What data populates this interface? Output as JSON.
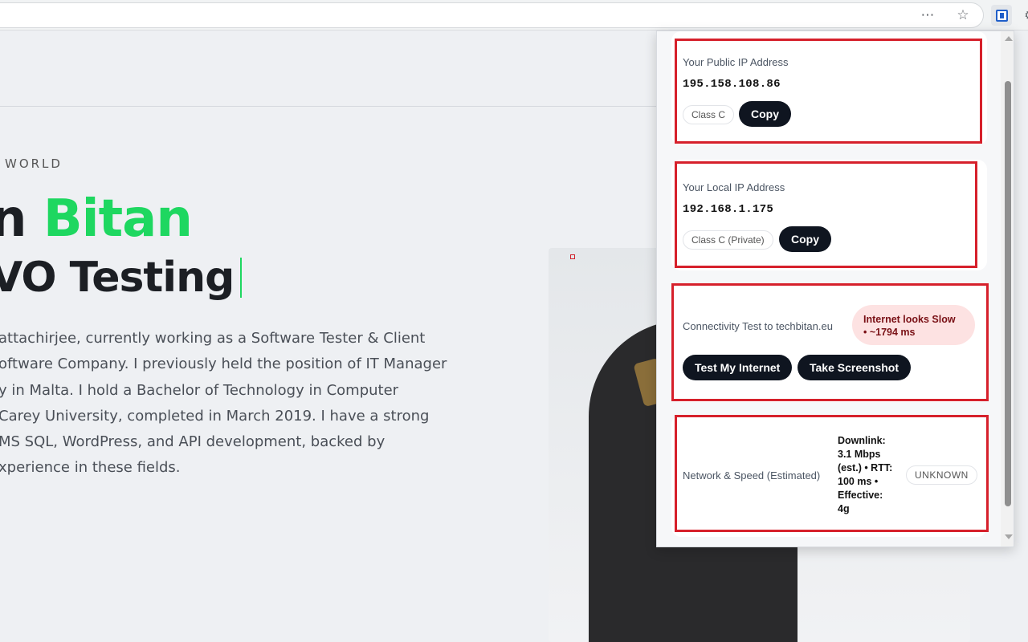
{
  "browser": {
    "more_icon": "more-horizontal-icon",
    "star_icon": "star-icon",
    "extension_icon": "ip-extension-icon"
  },
  "page": {
    "eyebrow": "WORLD",
    "name_prefix": "n ",
    "name_accent": "Bitan",
    "role": "VO Testing",
    "bio_lines": [
      "attachirjee, currently working as a Software Tester & Client",
      "oftware Company. I previously held the position of IT Manager",
      "y in Malta. I hold a Bachelor of Technology in Computer",
      " Carey University, completed in March 2019. I have a strong",
      " MS SQL, WordPress, and API development, backed by",
      "xperience in these fields."
    ],
    "accent_color": "#1ed760"
  },
  "popup": {
    "public_ip": {
      "label": "Your Public IP Address",
      "value": "195.158.108.86",
      "class": "Class C",
      "copy_label": "Copy"
    },
    "local_ip": {
      "label": "Your Local IP Address",
      "value": "192.168.1.175",
      "class": "Class C (Private)",
      "copy_label": "Copy"
    },
    "connectivity": {
      "label": "Connectivity Test to techbitan.eu",
      "status_line1": "Internet looks Slow",
      "status_line2": "• ~1794 ms",
      "test_button": "Test My Internet",
      "screenshot_button": "Take Screenshot"
    },
    "network": {
      "label": "Network & Speed (Estimated)",
      "details": [
        "Downlink:",
        "3.1 Mbps",
        "(est.) • RTT:",
        "100 ms •",
        "Effective:",
        "4g"
      ],
      "type_badge": "UNKNOWN"
    },
    "colors": {
      "highlight": "#d6202b",
      "button_bg": "#0f1520",
      "slow_badge_bg": "#fde2e2"
    }
  }
}
